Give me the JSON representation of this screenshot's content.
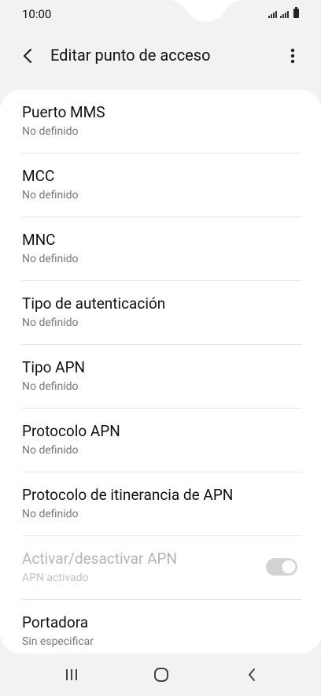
{
  "status_bar": {
    "time": "10:00"
  },
  "app_bar": {
    "title": "Editar punto de acceso"
  },
  "settings": [
    {
      "label": "Puerto MMS",
      "value": "No definido"
    },
    {
      "label": "MCC",
      "value": "No definido"
    },
    {
      "label": "MNC",
      "value": "No definido"
    },
    {
      "label": "Tipo de autenticación",
      "value": "No definido"
    },
    {
      "label": "Tipo APN",
      "value": "No definido"
    },
    {
      "label": "Protocolo APN",
      "value": "No definido"
    },
    {
      "label": "Protocolo de itinerancia de APN",
      "value": "No definido"
    },
    {
      "label": "Activar/desactivar APN",
      "value": "APN activado",
      "toggle_on": true,
      "disabled": true
    },
    {
      "label": "Portadora",
      "value": "Sin especificar"
    }
  ],
  "icons": {
    "back": "back-arrow-icon",
    "more": "more-vert-icon",
    "nav_recents": "recent-apps-icon",
    "nav_home": "home-icon",
    "nav_back": "back-icon"
  },
  "colors": {
    "background": "#f2f2f2",
    "card": "#ffffff",
    "primary_text": "#111111",
    "secondary_text": "#777777",
    "disabled_text": "#b5b5b5"
  }
}
